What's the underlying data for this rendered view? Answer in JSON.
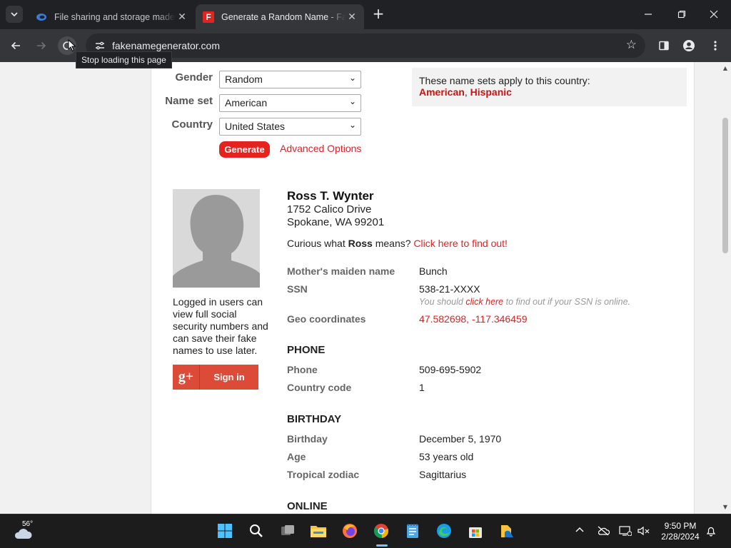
{
  "browser": {
    "tabs": [
      {
        "title": "File sharing and storage made simple",
        "active": false
      },
      {
        "title": "Generate a Random Name - Fake Name Generator",
        "active": true
      }
    ],
    "url": "fakenamegenerator.com",
    "tooltip": "Stop loading this page"
  },
  "form": {
    "gender_label": "Gender",
    "gender_value": "Random",
    "nameset_label": "Name set",
    "nameset_value": "American",
    "country_label": "Country",
    "country_value": "United States",
    "generate_label": "Generate",
    "advanced_label": "Advanced Options"
  },
  "nameset_info": {
    "text": "These name sets apply to this country:",
    "set1": "American",
    "sep": ",",
    "set2": "Hispanic"
  },
  "sidebar": {
    "login_note": "Logged in users can view full social security numbers and can save their fake names to use later.",
    "gplus_icon": "g+",
    "signin_label": "Sign in"
  },
  "person": {
    "name": "Ross T. Wynter",
    "street": "1752 Calico Drive",
    "city": "Spokane, WA 99201",
    "curious_prefix": "Curious what",
    "first_name": "Ross",
    "curious_suffix": "means?",
    "curious_link": "Click here to find out!",
    "maiden_label": "Mother's maiden name",
    "maiden_value": "Bunch",
    "ssn_label": "SSN",
    "ssn_value": "538-21-XXXX",
    "ssn_note_prefix": "You should",
    "ssn_note_link": "click here",
    "ssn_note_suffix": "to find out if your SSN is online.",
    "geo_label": "Geo coordinates",
    "geo_value": "47.582698, -117.346459",
    "phone_heading": "PHONE",
    "phone_label": "Phone",
    "phone_value": "509-695-5902",
    "cc_label": "Country code",
    "cc_value": "1",
    "birthday_heading": "BIRTHDAY",
    "birthday_label": "Birthday",
    "birthday_value": "December 5, 1970",
    "age_label": "Age",
    "age_value": "53 years old",
    "zodiac_label": "Tropical zodiac",
    "zodiac_value": "Sagittarius",
    "online_heading": "ONLINE"
  },
  "taskbar": {
    "temperature": "56°",
    "time": "9:50 PM",
    "date": "2/28/2024"
  },
  "colors": {
    "accent_red": "#e4231f",
    "link_red": "#dd2222",
    "chrome_dark": "#202124"
  }
}
